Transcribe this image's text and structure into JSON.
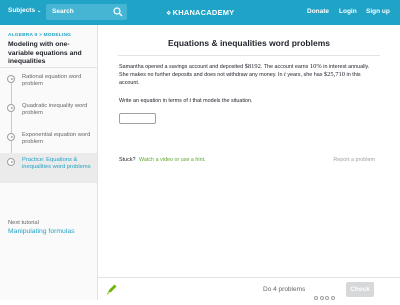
{
  "header": {
    "subjects_label": "Subjects",
    "search_placeholder": "Search",
    "logo_text": "KHANACADEMY",
    "donate_label": "Donate",
    "login_label": "Login",
    "signup_label": "Sign up",
    "accent_color": "#1fa3c7"
  },
  "sidebar": {
    "breadcrumb": "ALGEBRA II > MODELING",
    "unit_title": "Modeling with one-variable equations and inequalities",
    "items": [
      {
        "label": "Rational equation word problem",
        "icon": "play-icon",
        "active": false
      },
      {
        "label": "Quadratic inequality word problem",
        "icon": "play-icon",
        "active": false
      },
      {
        "label": "Exponential equation word problem",
        "icon": "play-icon",
        "active": false
      },
      {
        "label": "Practice: Equations & inequalities word problems",
        "icon": "exercise-icon",
        "active": true
      }
    ],
    "next_caption": "Next tutorial",
    "next_link": "Manipulating formulas"
  },
  "exercise": {
    "title": "Equations & inequalities word problems",
    "problem": {
      "p1": "Samantha opened a savings account and deposited ",
      "deposit": "$8192",
      "p2": ". The account earns ",
      "rate": "10%",
      "p3": " in interest annually. She makes no further deposits and does not withdraw any money. In ",
      "t": "t",
      "p4": " years, she has ",
      "amount": "$25,710",
      "p5": " in this account."
    },
    "prompt_a": "Write an equation in terms of ",
    "prompt_var": "t",
    "prompt_b": " that models the situation.",
    "answer_value": "",
    "stuck_label": "Stuck?",
    "hint_label": "Watch a video or use a hint.",
    "report_label": "Report a problem"
  },
  "footer": {
    "do_label": "Do 4 problems",
    "check_label": "Check",
    "progress_dots": 4,
    "completed": 0
  }
}
